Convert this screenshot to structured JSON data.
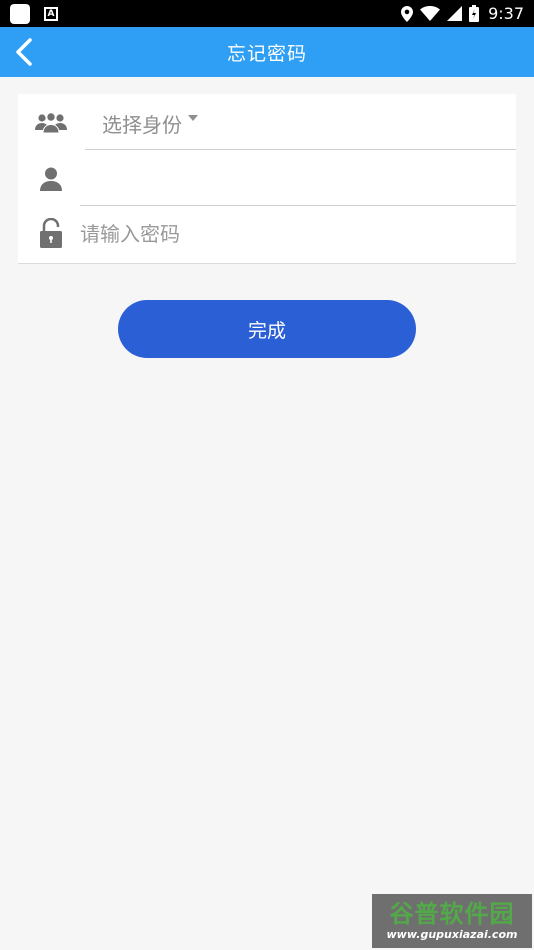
{
  "status_bar": {
    "time": "9:37",
    "badge_letter": "A",
    "icons": [
      "app-square-icon",
      "a-badge-icon",
      "location-icon",
      "wifi-icon",
      "signal-icon",
      "battery-icon"
    ]
  },
  "app_bar": {
    "title": "忘记密码",
    "back_icon": "chevron-left-icon",
    "color": "#2f9ff5"
  },
  "form": {
    "identity": {
      "icon": "users-group-icon",
      "selected_label": "选择身份"
    },
    "username": {
      "icon": "user-icon",
      "value": "",
      "placeholder": ""
    },
    "password": {
      "icon": "lock-icon",
      "value": "",
      "placeholder": "请输入密码"
    }
  },
  "actions": {
    "done_label": "完成",
    "done_color": "#2a5fd6"
  },
  "watermark": {
    "top_text": "谷普软件园",
    "bottom_text": "www.gupuxiazai.com"
  }
}
